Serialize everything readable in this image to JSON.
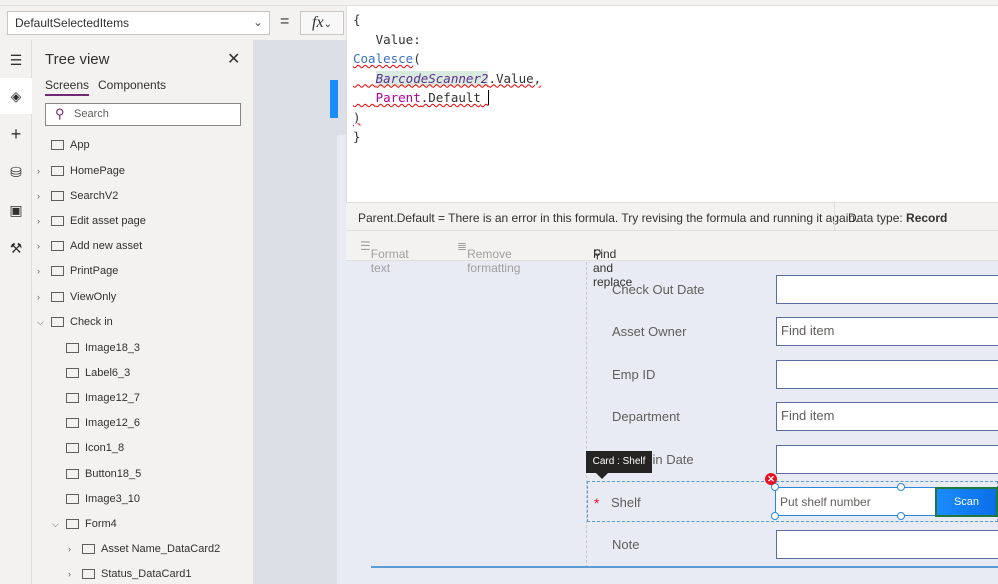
{
  "formula_bar": {
    "property": "DefaultSelectedItems",
    "equals": "=",
    "fx_label": "fx",
    "fx_chevron": "⌄",
    "code": {
      "l1": "{",
      "l2": "   Value:",
      "l3a": "Coalesce",
      "l3b": "(",
      "l4a": "BarcodeScanner2",
      "l4b": ".Value,",
      "l5a": "Parent",
      ".l5b": "",
      "l5b": ".Default",
      "l6": ")",
      "l7": "}"
    },
    "status_message": "Parent.Default  =  There is an error in this formula. Try revising the formula and running it again.",
    "data_type_label": "Data type: ",
    "data_type_value": "Record",
    "format_text": "Format text",
    "remove_formatting": "Remove formatting",
    "find_replace": "Find and replace"
  },
  "tree": {
    "title": "Tree view",
    "tabs": [
      "Screens",
      "Components"
    ],
    "search_placeholder": "Search",
    "items": [
      {
        "label": "App",
        "icon": "app-icon"
      },
      {
        "label": "HomePage",
        "icon": "screen-icon"
      },
      {
        "label": "SearchV2",
        "icon": "screen-icon"
      },
      {
        "label": "Edit asset page",
        "icon": "screen-icon"
      },
      {
        "label": "Add new asset",
        "icon": "screen-icon"
      },
      {
        "label": "PrintPage",
        "icon": "screen-icon"
      },
      {
        "label": "ViewOnly",
        "icon": "screen-icon"
      },
      {
        "label": "Check in",
        "icon": "screen-icon",
        "expanded": true
      },
      {
        "label": "Image18_3",
        "icon": "image-icon"
      },
      {
        "label": "Label6_3",
        "icon": "label-icon"
      },
      {
        "label": "Image12_7",
        "icon": "image-icon"
      },
      {
        "label": "Image12_6",
        "icon": "image-icon"
      },
      {
        "label": "Icon1_8",
        "icon": "icons-icon"
      },
      {
        "label": "Button18_5",
        "icon": "button-icon"
      },
      {
        "label": "Image3_10",
        "icon": "image-icon"
      },
      {
        "label": "Form4",
        "icon": "form-icon",
        "expanded": true
      },
      {
        "label": "Asset Name_DataCard2",
        "icon": "card-icon"
      },
      {
        "label": "Status_DataCard1",
        "icon": "card-icon"
      }
    ]
  },
  "form": {
    "fields": [
      {
        "label": "Check Out Date",
        "value": ""
      },
      {
        "label": "Asset Owner",
        "value": "Find item"
      },
      {
        "label": "Emp ID",
        "value": ""
      },
      {
        "label": "Department",
        "value": "Find item"
      },
      {
        "label": "Check in Date",
        "value": ""
      },
      {
        "label": "Shelf",
        "value": ""
      },
      {
        "label": "Note",
        "value": ""
      }
    ],
    "required_mark": "*",
    "shelf_placeholder": "Put shelf number",
    "scan_label": "Scan",
    "tooltip": "Card : Shelf"
  },
  "colors": {
    "accent": "#742774",
    "scan_button": "#1a8cff",
    "error": "#e81123"
  }
}
